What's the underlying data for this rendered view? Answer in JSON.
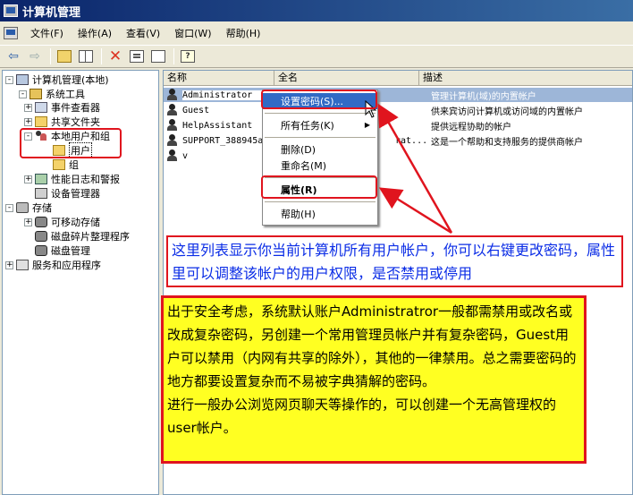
{
  "window": {
    "title": "计算机管理"
  },
  "menubar": {
    "items": [
      "文件(F)",
      "操作(A)",
      "查看(V)",
      "窗口(W)",
      "帮助(H)"
    ]
  },
  "tree": {
    "items": [
      {
        "label": "计算机管理(本地)",
        "expander": "-",
        "icon": "computer"
      },
      {
        "label": "系统工具",
        "expander": "-",
        "icon": "tools"
      },
      {
        "label": "事件查看器",
        "expander": "+",
        "icon": "event"
      },
      {
        "label": "共享文件夹",
        "expander": "+",
        "icon": "folder"
      },
      {
        "label": "本地用户和组",
        "expander": "-",
        "icon": "users"
      },
      {
        "label": "用户",
        "expander": "",
        "icon": "folder"
      },
      {
        "label": "组",
        "expander": "",
        "icon": "folder"
      },
      {
        "label": "性能日志和警报",
        "expander": "+",
        "icon": "perf"
      },
      {
        "label": "设备管理器",
        "expander": "",
        "icon": "device"
      },
      {
        "label": "存储",
        "expander": "-",
        "icon": "storage"
      },
      {
        "label": "可移动存储",
        "expander": "+",
        "icon": "disk"
      },
      {
        "label": "磁盘碎片整理程序",
        "expander": "",
        "icon": "disk"
      },
      {
        "label": "磁盘管理",
        "expander": "",
        "icon": "disk"
      },
      {
        "label": "服务和应用程序",
        "expander": "+",
        "icon": "services"
      }
    ]
  },
  "list": {
    "columns": [
      "名称",
      "全名",
      "描述"
    ],
    "rows": [
      {
        "name": "Administrator",
        "fullname": "",
        "desc": "管理计算机(域)的内置帐户"
      },
      {
        "name": "Guest",
        "fullname": "",
        "desc": "供来宾访问计算机或访问域的内置帐户"
      },
      {
        "name": "HelpAssistant",
        "fullname": "",
        "desc": "提供远程协助的帐户"
      },
      {
        "name": "SUPPORT_388945a",
        "fullname": "rat...",
        "desc": "这是一个帮助和支持服务的提供商帐户"
      },
      {
        "name": "v",
        "fullname": "",
        "desc": ""
      }
    ]
  },
  "context_menu": {
    "items": [
      {
        "label": "设置密码(S)...",
        "type": "item"
      },
      {
        "label": "",
        "type": "sep"
      },
      {
        "label": "所有任务(K)",
        "type": "submenu"
      },
      {
        "label": "",
        "type": "sep"
      },
      {
        "label": "删除(D)",
        "type": "item"
      },
      {
        "label": "重命名(M)",
        "type": "item"
      },
      {
        "label": "",
        "type": "sep"
      },
      {
        "label": "属性(R)",
        "type": "bold"
      },
      {
        "label": "",
        "type": "sep"
      },
      {
        "label": "帮助(H)",
        "type": "item"
      }
    ]
  },
  "callouts": {
    "blue_text": "这里列表显示你当前计算机所有用户帐户，你可以右键更改密码，属性里可以调整该帐户的用户权限，是否禁用或停用",
    "yellow_lines": [
      "出于安全考虑，系统默认账户Administratror一般都需禁用或改名或改成复杂密码，另创建一个常用管理员帐户并有复杂密码，Guest用户可以禁用（内网有共享的除外），其他的一律禁用。总之需要密码的地方都要设置复杂而不易被字典猜解的密码。",
      "进行一般办公浏览网页聊天等操作的，可以创建一个无高管理权的user帐户。"
    ]
  },
  "colors": {
    "annotation_red": "#e0141e",
    "callout_blue_text": "#0b2de6",
    "callout_yellow_bg": "#ffff22",
    "title_blue": "#0a246a"
  }
}
